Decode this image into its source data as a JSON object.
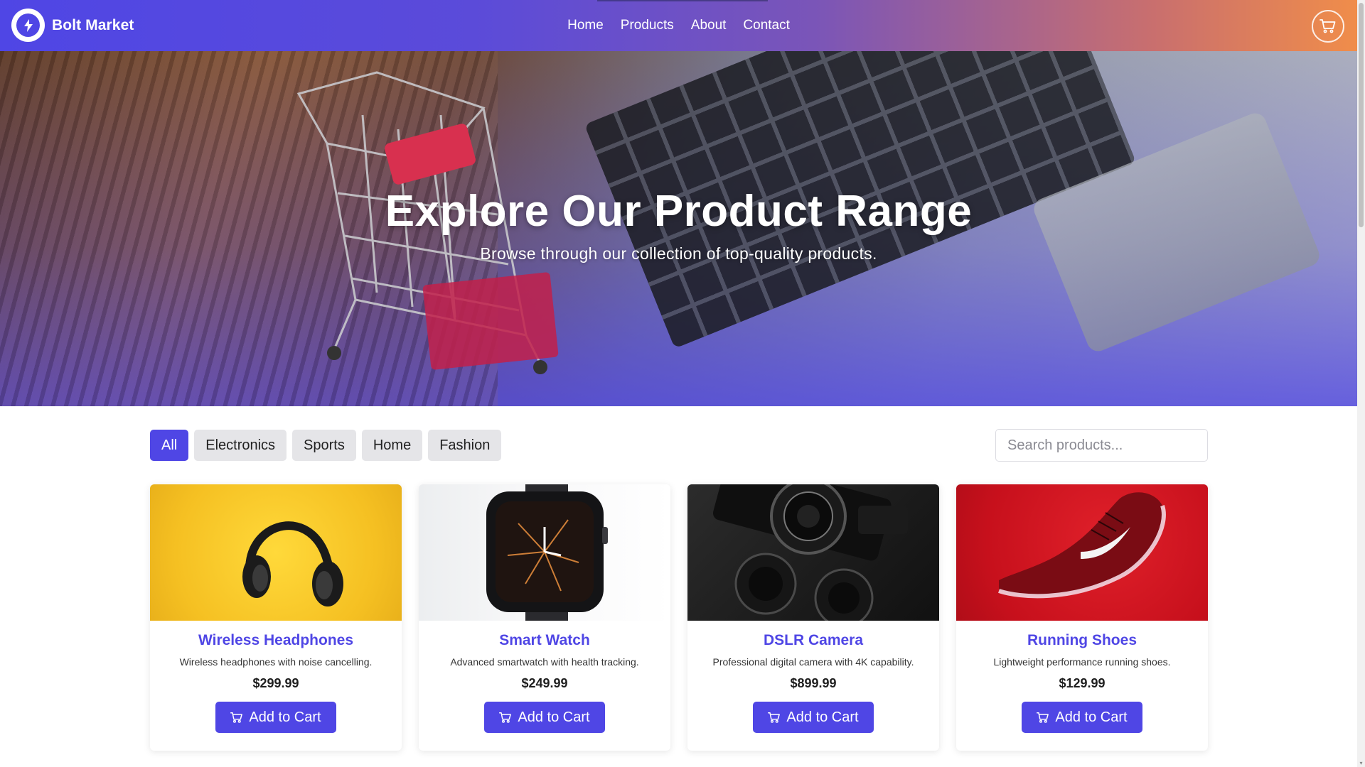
{
  "brand": {
    "name": "Bolt Market",
    "logo_icon": "bolt-icon"
  },
  "nav": {
    "items": [
      {
        "label": "Home"
      },
      {
        "label": "Products"
      },
      {
        "label": "About"
      },
      {
        "label": "Contact"
      }
    ],
    "cart_icon": "cart-icon"
  },
  "hero": {
    "title": "Explore Our Product Range",
    "subtitle": "Browse through our collection of top-quality products."
  },
  "filters": {
    "items": [
      {
        "label": "All",
        "active": true
      },
      {
        "label": "Electronics",
        "active": false
      },
      {
        "label": "Sports",
        "active": false
      },
      {
        "label": "Home",
        "active": false
      },
      {
        "label": "Fashion",
        "active": false
      }
    ]
  },
  "search": {
    "placeholder": "Search products...",
    "value": ""
  },
  "products": [
    {
      "name": "Wireless Headphones",
      "description": "Wireless headphones with noise cancelling.",
      "price": "$299.99",
      "button": "Add to Cart",
      "image_icon": "headphones-image"
    },
    {
      "name": "Smart Watch",
      "description": "Advanced smartwatch with health tracking.",
      "price": "$249.99",
      "button": "Add to Cart",
      "image_icon": "smartwatch-image"
    },
    {
      "name": "DSLR Camera",
      "description": "Professional digital camera with 4K capability.",
      "price": "$899.99",
      "button": "Add to Cart",
      "image_icon": "camera-image"
    },
    {
      "name": "Running Shoes",
      "description": "Lightweight performance running shoes.",
      "price": "$129.99",
      "button": "Add to Cart",
      "image_icon": "shoe-image"
    }
  ],
  "colors": {
    "primary": "#4f46e5",
    "header_gradient_start": "#4f46e5",
    "header_gradient_end": "#f08d4a",
    "filter_inactive_bg": "#e5e5e8",
    "price_text": "#1f1f1f"
  }
}
